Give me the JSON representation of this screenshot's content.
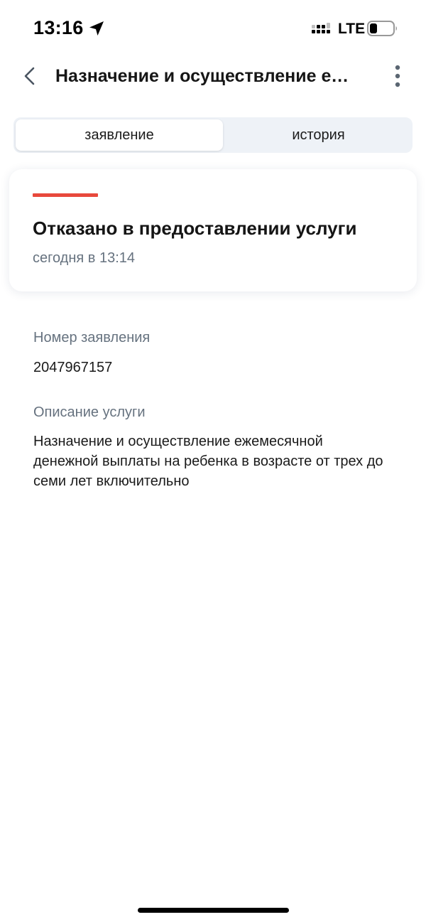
{
  "status_bar": {
    "time": "13:16",
    "network": "LTE",
    "icons": [
      "location-arrow-icon",
      "signal-icon",
      "battery-icon"
    ]
  },
  "header": {
    "title": "Назначение и осуществление ежемесячной денежной выплаты на ребенка в возрасте от трех до семи лет включительно",
    "back_icon": "chevron-left-icon",
    "more_icon": "more-vertical-icon"
  },
  "tabs": [
    {
      "label": "заявление",
      "active": true
    },
    {
      "label": "история",
      "active": false
    }
  ],
  "status_card": {
    "title": "Отказано в предоставлении услуги",
    "date": "сегодня в 13:14",
    "status_color": "#e8493c"
  },
  "fields": {
    "number_label": "Номер заявления",
    "number_value": "2047967157",
    "description_label": "Описание услуги",
    "description_value": "Назначение и осуществление ежемесячной денежной выплаты на ребенка в возрасте от трех до семи лет включительно"
  },
  "colors": {
    "accent_red": "#e8493c",
    "secondary_text": "#66727f",
    "tab_track": "#eef2f7"
  }
}
